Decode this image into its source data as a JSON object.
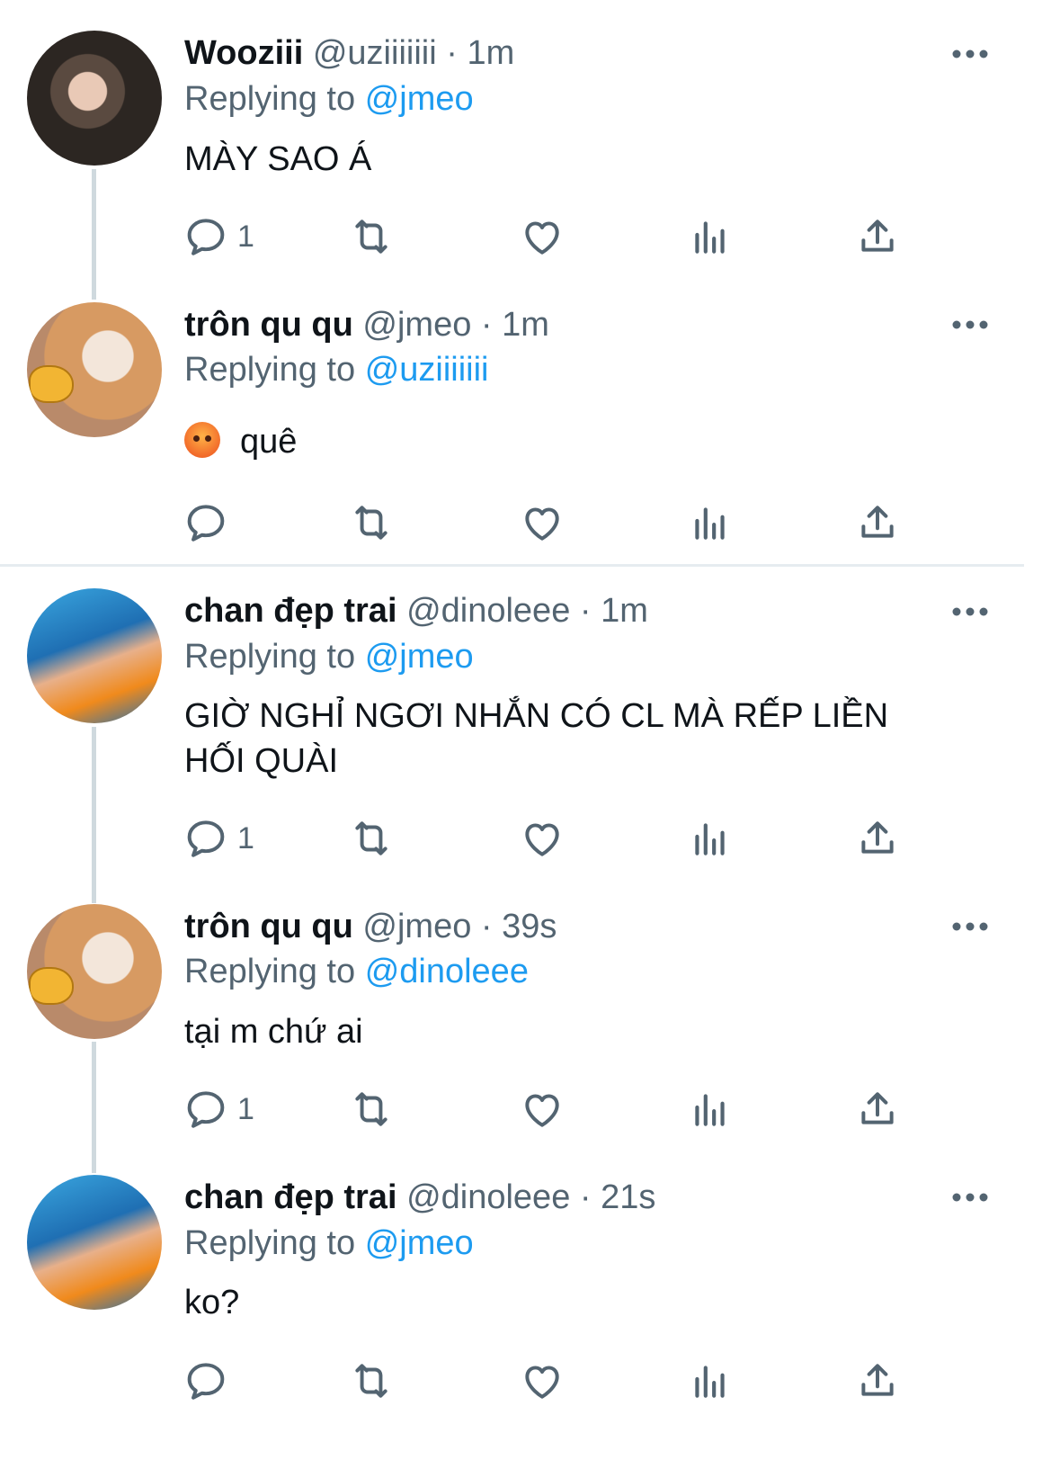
{
  "tweets": [
    {
      "name": "Wooziii",
      "handle": "@uziiiiiii",
      "time": "1m",
      "replying_prefix": "Replying to",
      "replying_to": "@jmeo",
      "text": "MÀY SAO Á",
      "reply_count": "1",
      "avatar": "woozi-avatar"
    },
    {
      "name": "trôn qu qu",
      "handle": "@jmeo",
      "time": "1m",
      "replying_prefix": "Replying to",
      "replying_to": "@uziiiiiii",
      "text": "quê",
      "emoji": "angry-face-emoji",
      "reply_count": "",
      "avatar": "cat-avatar"
    },
    {
      "name": "chan đẹp trai",
      "handle": "@dinoleee",
      "time": "1m",
      "replying_prefix": "Replying to",
      "replying_to": "@jmeo",
      "text": "GIỜ NGHỈ NGƠI NHẮN CÓ CL MÀ RẾP LIỀN HỐI QUÀI",
      "reply_count": "1",
      "avatar": "chan-avatar"
    },
    {
      "name": "trôn qu qu",
      "handle": "@jmeo",
      "time": "39s",
      "replying_prefix": "Replying to",
      "replying_to": "@dinoleee",
      "text": "tại m chứ ai",
      "reply_count": "1",
      "avatar": "cat-avatar"
    },
    {
      "name": "chan đẹp trai",
      "handle": "@dinoleee",
      "time": "21s",
      "replying_prefix": "Replying to",
      "replying_to": "@jmeo",
      "text": "ko?",
      "reply_count": "",
      "avatar": "chan-avatar"
    }
  ],
  "separator": "·",
  "icons": [
    "reply-icon",
    "retweet-icon",
    "like-icon",
    "views-icon",
    "share-icon",
    "more-icon"
  ],
  "colors": {
    "text": "#0f1419",
    "secondary": "#536471",
    "mention": "#1d9bf0",
    "thread_line": "#cfd9de",
    "divider": "#e6ecf0"
  }
}
